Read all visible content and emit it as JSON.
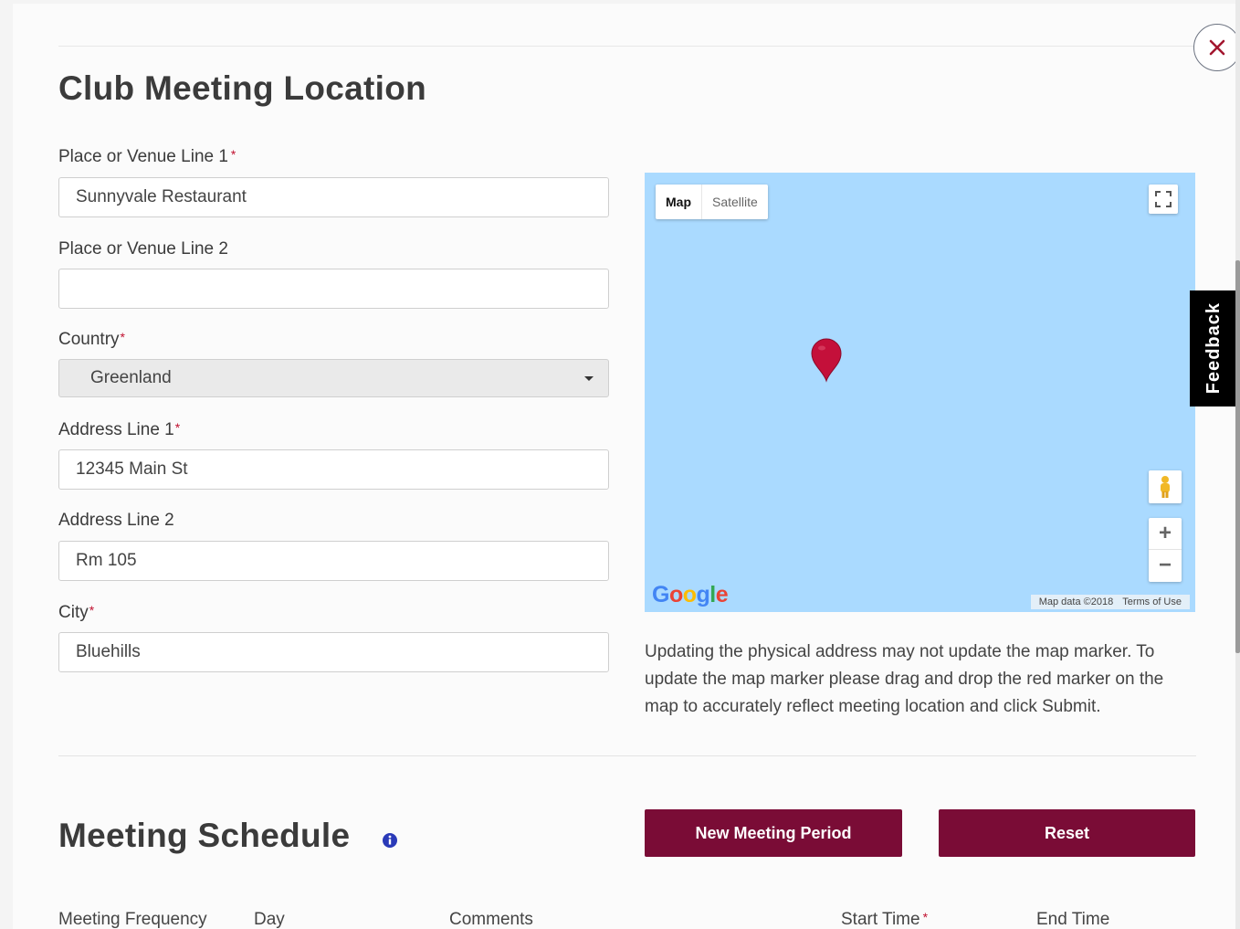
{
  "section": {
    "title": "Club Meeting Location"
  },
  "form": {
    "place_line1": {
      "label": "Place or Venue Line 1",
      "value": "Sunnyvale Restaurant"
    },
    "place_line2": {
      "label": "Place or Venue Line 2",
      "value": ""
    },
    "country": {
      "label": "Country",
      "value": "Greenland"
    },
    "address_line1": {
      "label": "Address Line 1",
      "value": "12345 Main St"
    },
    "address_line2": {
      "label": "Address Line 2",
      "value": "Rm 105"
    },
    "city": {
      "label": "City",
      "value": "Bluehills"
    },
    "required_mark": "*"
  },
  "map": {
    "type_map": "Map",
    "type_satellite": "Satellite",
    "logo": [
      "G",
      "o",
      "o",
      "g",
      "l",
      "e"
    ],
    "attribution_data": "Map data ©2018",
    "attribution_terms": "Terms of Use",
    "zoom_in": "+",
    "zoom_out": "−",
    "water_color": "#aadaff",
    "marker_color": "#c4103a",
    "icons": [
      "fullscreen-icon",
      "pegman-icon",
      "map-marker-icon"
    ]
  },
  "map_note": "Updating the physical address may not update the map marker. To update the map marker please drag and drop the red marker on the map to accurately reflect meeting location and click Submit.",
  "schedule": {
    "title": "Meeting Schedule",
    "new_period_button": "New Meeting Period",
    "reset_button": "Reset",
    "columns": [
      "Meeting Frequency",
      "Day",
      "Comments",
      "Start Time",
      "End Time"
    ]
  },
  "feedback_tab": "Feedback",
  "colors": {
    "brand": "#7a0c36",
    "required": "#c0102f",
    "info_icon": "#2a3ab8"
  }
}
